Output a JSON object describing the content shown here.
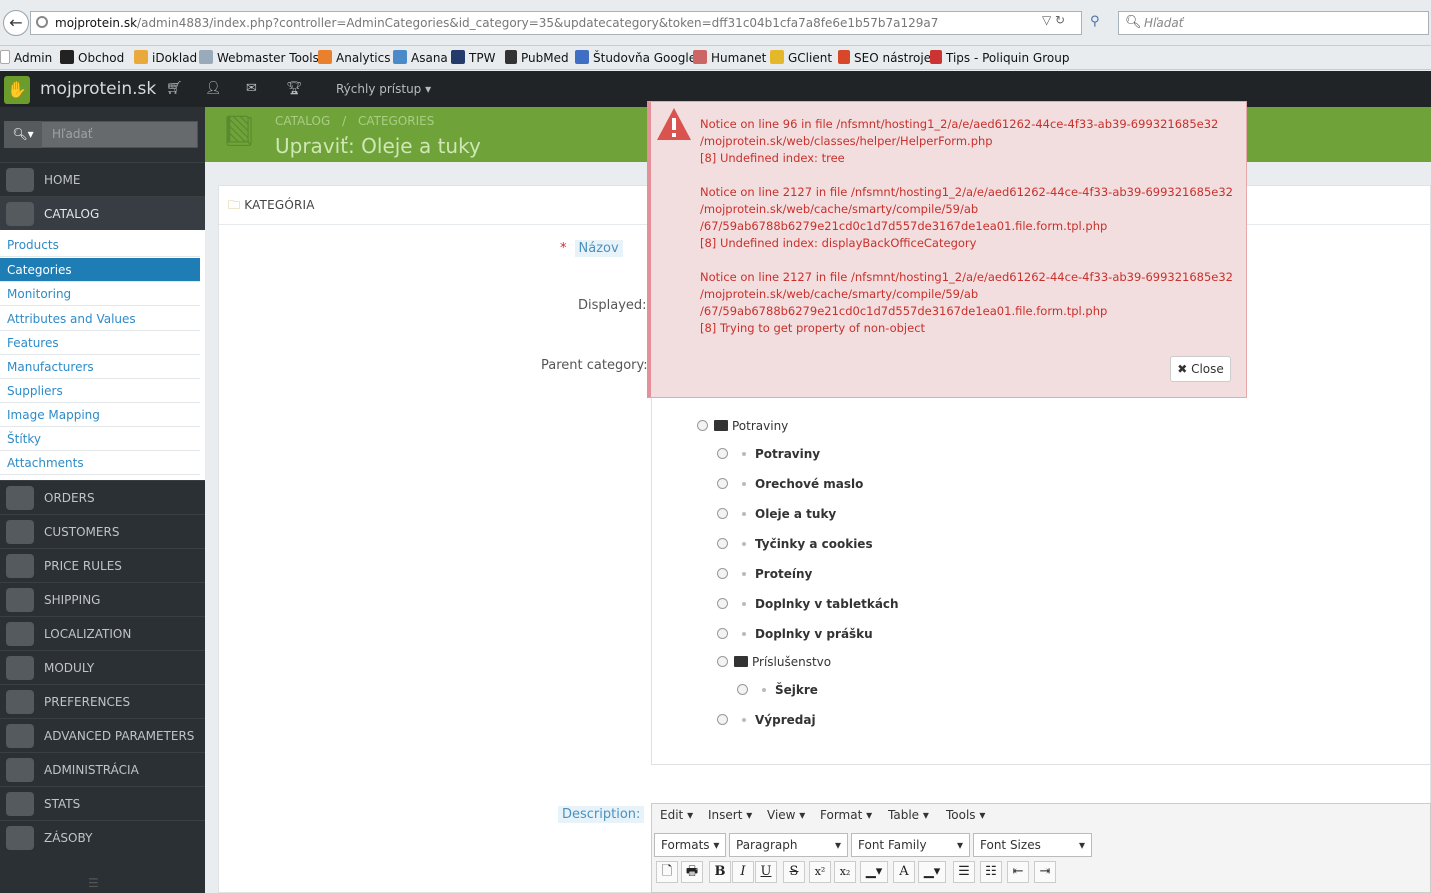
{
  "browser": {
    "url_host": "mojprotein.sk",
    "url_path": "/admin4883/index.php?controller=AdminCategories&id_category=35&updatecategory&token=dff31c04b1cfa7a8fe6e1b57b7a129a7",
    "search_placeholder": "Hľadať",
    "bookmarks": [
      "Admin",
      "Obchod",
      "iDoklad",
      "Webmaster Tools",
      "Analytics",
      "Asana",
      "TPW",
      "PubMed",
      "Študovňa Google",
      "Humanet",
      "GClient",
      "SEO nástroje",
      "Tips - Poliquin Group"
    ]
  },
  "header": {
    "shop_name": "mojprotein.sk",
    "quick_access": "Rýchly prístup"
  },
  "page": {
    "breadcrumb_1": "CATALOG",
    "breadcrumb_sep": "/",
    "breadcrumb_2": "CATEGORIES",
    "title": "Upraviť: Oleje a tuky"
  },
  "sidebar": {
    "search_placeholder": "Hľadať",
    "items": [
      "HOME",
      "CATALOG",
      "ORDERS",
      "CUSTOMERS",
      "PRICE RULES",
      "SHIPPING",
      "LOCALIZATION",
      "MODULY",
      "PREFERENCES",
      "ADVANCED PARAMETERS",
      "ADMINISTRÁCIA",
      "STATS",
      "ZÁSOBY"
    ],
    "submenu": [
      "Products",
      "Categories",
      "Monitoring",
      "Attributes and Values",
      "Features",
      "Manufacturers",
      "Suppliers",
      "Image Mapping",
      "Štítky",
      "Attachments"
    ]
  },
  "form": {
    "panel_title": "KATEGÓRIA",
    "name_label": "Názov",
    "required_mark": "*",
    "displayed_label": "Displayed:",
    "parent_label": "Parent category:",
    "description_label": "Description:"
  },
  "tree": {
    "root": "Potraviny",
    "children": [
      "Potraviny",
      "Orechové maslo",
      "Oleje a tuky",
      "Tyčinky a cookies",
      "Proteíny",
      "Doplnky v tabletkách",
      "Doplnky v prášku"
    ],
    "folder2": "Príslušenstvo",
    "folder2_children": [
      "Šejkre"
    ],
    "last": "Výpredaj"
  },
  "editor": {
    "menus": [
      "Edit",
      "Insert",
      "View",
      "Format",
      "Table",
      "Tools"
    ],
    "dropdowns": [
      "Formats",
      "Paragraph",
      "Font Family",
      "Font Sizes"
    ],
    "buttons": [
      "🗋",
      "🖶",
      "B",
      "I",
      "U",
      "S",
      "x²",
      "x₂",
      "A"
    ]
  },
  "error": {
    "lines": [
      [
        "Notice on line 96 in file /nfsmnt/hosting1_2/a/e/aed61262-44ce-4f33-ab39-699321685e32",
        "/mojprotein.sk/web/classes/helper/HelperForm.php",
        "[8] Undefined index: tree"
      ],
      [
        "Notice on line 2127 in file /nfsmnt/hosting1_2/a/e/aed61262-44ce-4f33-ab39-699321685e32",
        "/mojprotein.sk/web/cache/smarty/compile/59/ab",
        "/67/59ab6788b6279e21cd0c1d7d557de3167de1ea01.file.form.tpl.php",
        "[8] Undefined index: displayBackOfficeCategory"
      ],
      [
        "Notice on line 2127 in file /nfsmnt/hosting1_2/a/e/aed61262-44ce-4f33-ab39-699321685e32",
        "/mojprotein.sk/web/cache/smarty/compile/59/ab",
        "/67/59ab6788b6279e21cd0c1d7d557de3167de1ea01.file.form.tpl.php",
        "[8] Trying to get property of non-object"
      ]
    ],
    "close_label": "Close"
  }
}
